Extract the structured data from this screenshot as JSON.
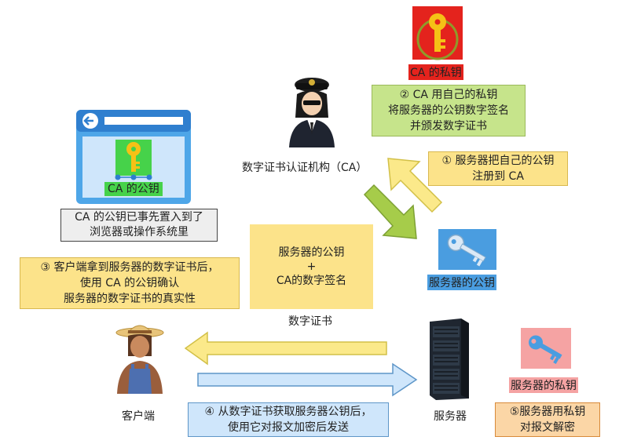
{
  "ca_private_key": {
    "label": "CA 的私钥",
    "icon": "key-icon"
  },
  "ca_authority": {
    "label": "数字证书认证机构（CA）",
    "icon": "official-icon"
  },
  "step2": {
    "line1": "② CA 用自己的私钥",
    "line2": "将服务器的公钥数字签名",
    "line3": "并颁发数字证书"
  },
  "step1": {
    "line1": "① 服务器把自己的公钥",
    "line2": "注册到 CA"
  },
  "browser": {
    "key_label": "CA 的公钥",
    "icon": "browser-window-icon"
  },
  "browser_note": {
    "line1": "CA 的公钥已事先置入到了",
    "line2": "浏览器或操作系统里"
  },
  "certificate": {
    "line1": "服务器的公钥",
    "line2": "+",
    "line3": "CA的数字签名",
    "caption": "数字证书"
  },
  "server_public_key": {
    "label": "服务器的公钥",
    "icon": "key-icon"
  },
  "step3": {
    "line1": "③ 客户端拿到服务器的数字证书后，",
    "line2": "使用 CA 的公钥确认",
    "line3": "服务器的数字证书的真实性"
  },
  "client": {
    "label": "客户端",
    "icon": "farmer-icon"
  },
  "server": {
    "label": "服务器",
    "icon": "server-rack-icon"
  },
  "server_private_key": {
    "label": "服务器的私钥",
    "icon": "key-icon"
  },
  "step4": {
    "line1": "④ 从数字证书获取服务器公钥后，",
    "line2": "使用它对报文加密后发送"
  },
  "step5": {
    "line1": "⑤服务器用私钥",
    "line2": "对报文解密"
  },
  "colors": {
    "yellow_box": "#fce38a",
    "green_box": "#c6e48b",
    "gray_box": "#eeeeee",
    "blue_box": "#cfe6fb",
    "orange_box": "#fbd6a6",
    "red": "#e02020",
    "blue_key": "#4a9de0"
  }
}
